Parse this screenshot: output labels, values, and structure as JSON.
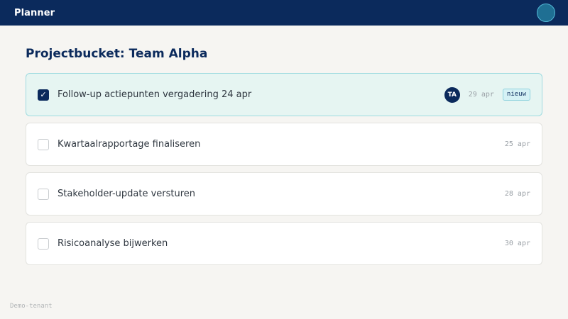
{
  "app": {
    "title": "Planner"
  },
  "page": {
    "title": "Projectbucket: Team Alpha"
  },
  "tasks": [
    {
      "title": "Follow-up actiepunten vergadering 24 apr",
      "checked": true,
      "assignee_initials": "TA",
      "due": "29 apr",
      "badge": "nieuw",
      "selected": true
    },
    {
      "title": "Kwartaalrapportage finaliseren",
      "checked": false,
      "due": "25 apr"
    },
    {
      "title": "Stakeholder-update versturen",
      "checked": false,
      "due": "28 apr"
    },
    {
      "title": "Risicoanalyse bijwerken",
      "checked": false,
      "due": "30 apr"
    }
  ],
  "footer": {
    "tenant": "Demo-tenant"
  },
  "colors": {
    "brand": "#0b2a5c",
    "selected_bg": "#e6f5f2",
    "badge_bg": "#d5f1f5"
  },
  "icons": {
    "check": "check-icon",
    "user": "user-avatar"
  }
}
